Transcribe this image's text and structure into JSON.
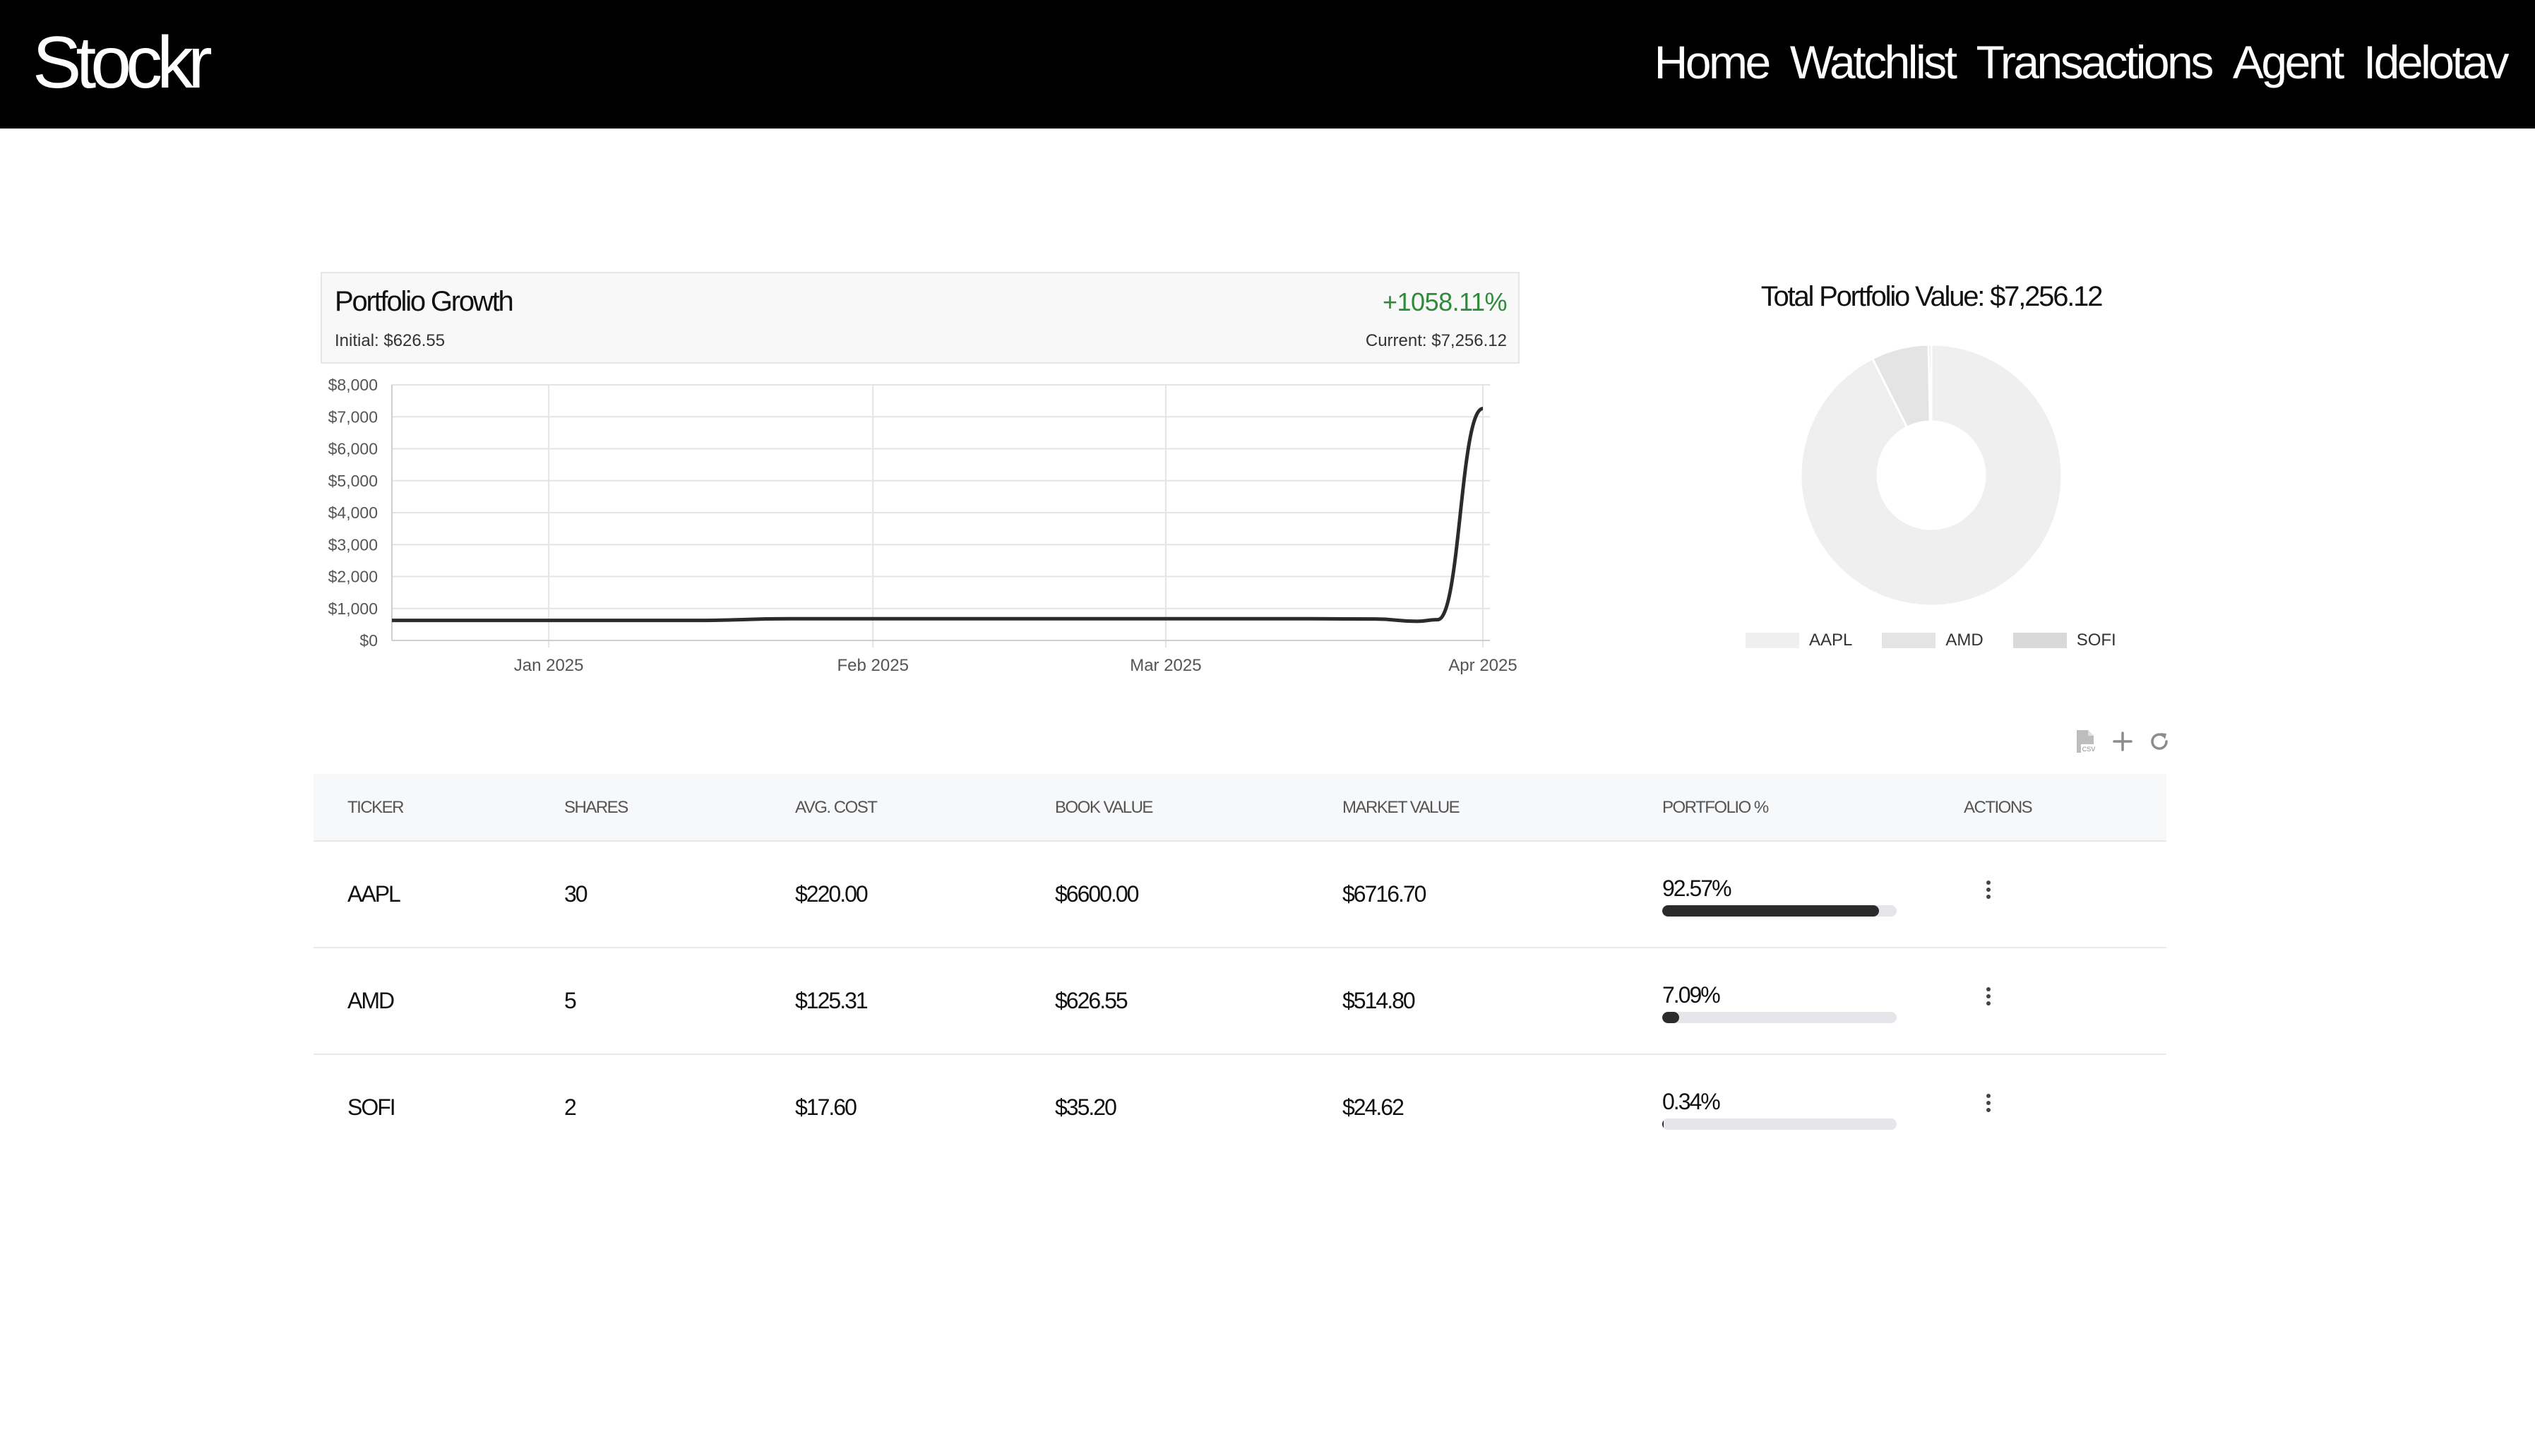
{
  "app": {
    "brand": "Stockr"
  },
  "nav": {
    "items": [
      "Home",
      "Watchlist",
      "Transactions",
      "Agent",
      "Idelotav"
    ]
  },
  "growth": {
    "title": "Portfolio Growth",
    "change_pct": "+1058.11%",
    "initial_label": "Initial: $626.55",
    "current_label": "Current: $7,256.12",
    "line_color": "#2b2b2b",
    "positive_color": "#2e8b3a"
  },
  "allocation": {
    "title": "Total Portfolio Value: $7,256.12"
  },
  "toolbar": {
    "icons": [
      "csv-export-icon",
      "add-icon",
      "refresh-icon"
    ]
  },
  "table": {
    "headers": [
      "TICKER",
      "SHARES",
      "AVG. COST",
      "BOOK VALUE",
      "MARKET VALUE",
      "PORTFOLIO %",
      "ACTIONS"
    ],
    "rows": [
      {
        "ticker": "AAPL",
        "shares": "30",
        "avg_cost": "$220.00",
        "book_value": "$6600.00",
        "market_value": "$6716.70",
        "portfolio_pct": "92.57%",
        "pct_value": 92.57
      },
      {
        "ticker": "AMD",
        "shares": "5",
        "avg_cost": "$125.31",
        "book_value": "$626.55",
        "market_value": "$514.80",
        "portfolio_pct": "7.09%",
        "pct_value": 7.09
      },
      {
        "ticker": "SOFI",
        "shares": "2",
        "avg_cost": "$17.60",
        "book_value": "$35.20",
        "market_value": "$24.62",
        "portfolio_pct": "0.34%",
        "pct_value": 0.34
      }
    ]
  },
  "chart_data": [
    {
      "type": "line",
      "title": "Portfolio Growth",
      "x_tick_labels": [
        "Jan 2025",
        "Feb 2025",
        "Mar 2025",
        "Apr 2025"
      ],
      "y_tick_labels": [
        "$0",
        "$1,000",
        "$2,000",
        "$3,000",
        "$4,000",
        "$5,000",
        "$6,000",
        "$7,000",
        "$8,000"
      ],
      "ylim": [
        0,
        8000
      ],
      "xlim": [
        "2024-12-17",
        "2025-04-01"
      ],
      "grid": true,
      "series": [
        {
          "x": [
            "2024-12-17",
            "2025-01-01",
            "2025-01-15",
            "2025-01-24",
            "2025-02-01",
            "2025-02-15",
            "2025-03-01",
            "2025-03-15",
            "2025-03-21",
            "2025-03-25",
            "2025-03-27",
            "2025-04-01"
          ],
          "y": [
            626.55,
            626.55,
            626.55,
            680,
            680,
            680,
            680,
            680,
            670,
            600,
            650,
            7256.12
          ],
          "color": "#2b2b2b"
        }
      ]
    },
    {
      "type": "pie",
      "title": "Total Portfolio Value: $7,256.12",
      "labels": [
        "AAPL",
        "AMD",
        "SOFI"
      ],
      "values": [
        6716.7,
        514.8,
        24.62
      ],
      "colors": [
        "#efefef",
        "#e4e4e4",
        "#d9d9d9"
      ],
      "legend": "bottom"
    }
  ]
}
